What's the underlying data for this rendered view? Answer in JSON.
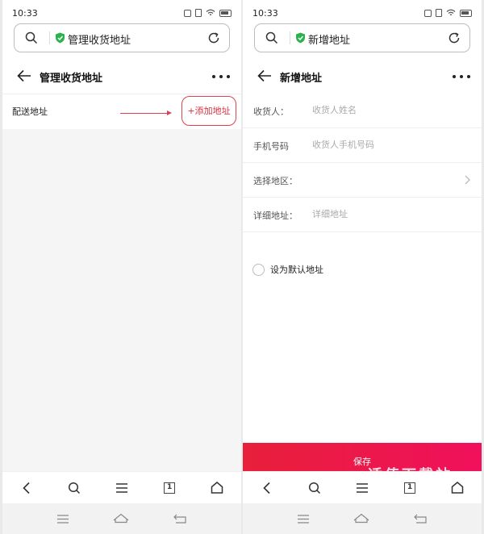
{
  "status": {
    "time": "10:33"
  },
  "left_screen": {
    "url_text": "管理收货地址",
    "page_title": "管理收货地址",
    "section_label": "配送地址",
    "add_button_label": "+添加地址"
  },
  "right_screen": {
    "url_text": "新增地址",
    "page_title": "新增地址",
    "fields": [
      {
        "label": "收货人：",
        "placeholder": "收货人姓名"
      },
      {
        "label": "手机号码",
        "placeholder": "收货人手机号码"
      },
      {
        "label": "选择地区：",
        "placeholder": ""
      },
      {
        "label": "详细地址：",
        "placeholder": "详细地址"
      }
    ],
    "default_label": "设为默认地址",
    "save_label": "保存",
    "watermark": "适值下载站"
  },
  "toolbar": {
    "tabs_count": "1"
  },
  "colors": {
    "accent": "#e8203a",
    "shield": "#2bb24c"
  },
  "icons": [
    "search-icon",
    "shield-icon",
    "refresh-icon",
    "back-arrow-icon",
    "more-icon",
    "chevron-right-icon",
    "back-icon",
    "search-icon",
    "menu-icon",
    "tabs-icon",
    "home-icon"
  ]
}
